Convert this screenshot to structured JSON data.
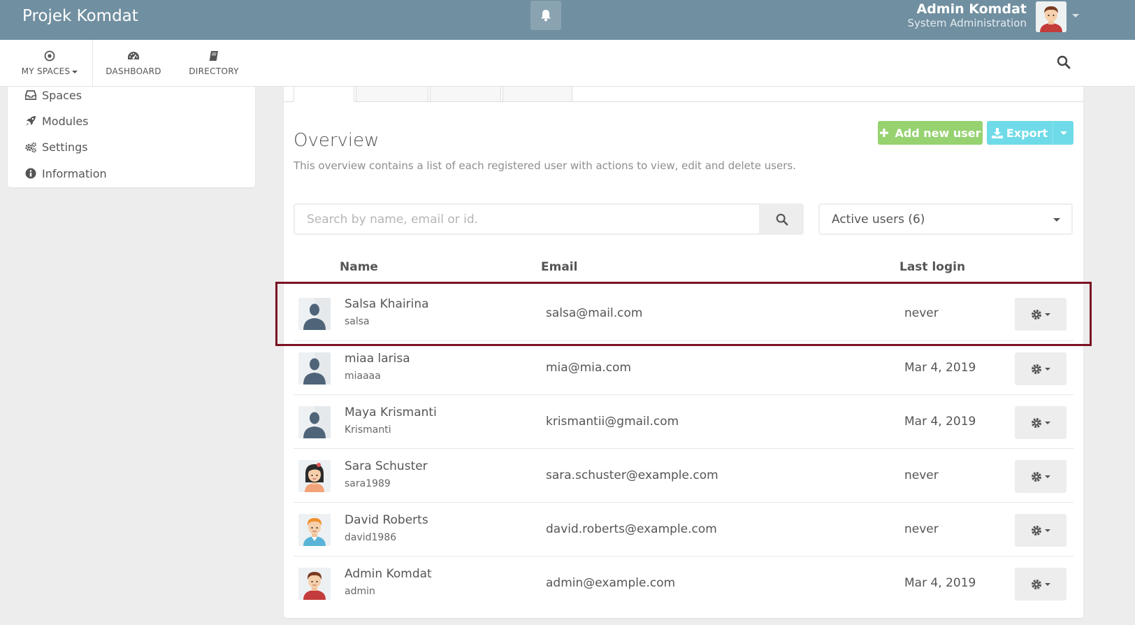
{
  "topbar": {
    "brand": "Projek Komdat",
    "user_name": "Admin Komdat",
    "user_role": "System Administration",
    "icons": [
      "bell-icon",
      "avatar-icon",
      "chevron-down-icon"
    ]
  },
  "nav": {
    "items": [
      {
        "label": "MY SPACES",
        "icon": "dot-circle-icon"
      },
      {
        "label": "DASHBOARD",
        "icon": "tachometer-icon"
      },
      {
        "label": "DIRECTORY",
        "icon": "book-icon"
      }
    ],
    "search_icon": "search-icon"
  },
  "sidebar": {
    "items": [
      {
        "label": "Spaces",
        "icon": "inbox-icon"
      },
      {
        "label": "Modules",
        "icon": "rocket-icon"
      },
      {
        "label": "Settings",
        "icon": "gears-icon"
      },
      {
        "label": "Information",
        "icon": "info-circle-icon"
      }
    ]
  },
  "overview": {
    "title": "Overview",
    "description": "This overview contains a list of each registered user with actions to view, edit and delete users.",
    "add_button": "Add new user",
    "export_button": "Export",
    "search_placeholder": "Search by name, email or id.",
    "filter_selected": "Active users (6)"
  },
  "table": {
    "headers": {
      "name": "Name",
      "email": "Email",
      "last_login": "Last login"
    },
    "rows": [
      {
        "name": "Salsa Khairina",
        "username": "salsa",
        "email": "salsa@mail.com",
        "last_login": "never",
        "avatar": "default-avatar"
      },
      {
        "name": "miaa larisa",
        "username": "miaaaa",
        "email": "mia@mia.com",
        "last_login": "Mar 4, 2019",
        "avatar": "default-avatar"
      },
      {
        "name": "Maya Krismanti",
        "username": "Krismanti",
        "email": "krismantii@gmail.com",
        "last_login": "Mar 4, 2019",
        "avatar": "default-avatar"
      },
      {
        "name": "Sara Schuster",
        "username": "sara1989",
        "email": "sara.schuster@example.com",
        "last_login": "never",
        "avatar": "female-avatar"
      },
      {
        "name": "David Roberts",
        "username": "david1986",
        "email": "david.roberts@example.com",
        "last_login": "never",
        "avatar": "male-blond-avatar"
      },
      {
        "name": "Admin Komdat",
        "username": "admin",
        "email": "admin@example.com",
        "last_login": "Mar 4, 2019",
        "avatar": "male-red-avatar"
      }
    ]
  },
  "colors": {
    "topbar": "#708fa0",
    "success": "#97d271",
    "info": "#6fdbe8",
    "highlight_border": "#7a1222"
  }
}
